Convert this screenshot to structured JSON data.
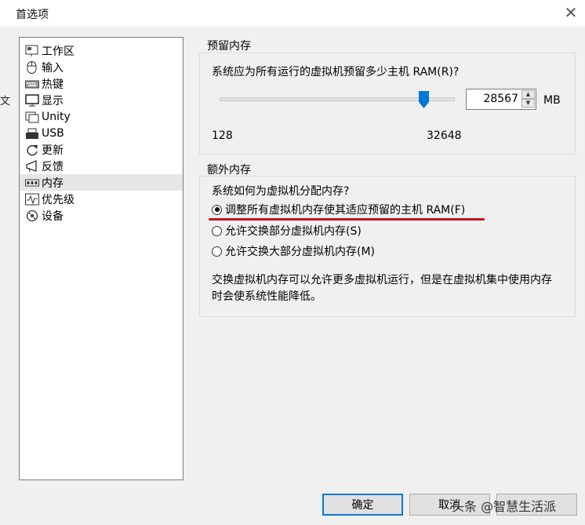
{
  "window": {
    "title": "首选项",
    "close_glyph": "✕"
  },
  "background_fragment": "文",
  "nav": {
    "items": [
      {
        "label": "工作区",
        "icon": "workspace-icon"
      },
      {
        "label": "输入",
        "icon": "mouse-icon"
      },
      {
        "label": "热键",
        "icon": "keyboard-icon"
      },
      {
        "label": "显示",
        "icon": "monitor-icon"
      },
      {
        "label": "Unity",
        "icon": "unity-icon"
      },
      {
        "label": "USB",
        "icon": "usb-icon"
      },
      {
        "label": "更新",
        "icon": "refresh-icon"
      },
      {
        "label": "反馈",
        "icon": "feedback-icon"
      },
      {
        "label": "内存",
        "icon": "memory-icon",
        "selected": true
      },
      {
        "label": "优先级",
        "icon": "priority-icon"
      },
      {
        "label": "设备",
        "icon": "device-icon"
      }
    ]
  },
  "reserved_memory": {
    "title": "预留内存",
    "question": "系统应为所有运行的虚拟机预留多少主机 RAM(R)?",
    "slider": {
      "min": 128,
      "max": 32648,
      "value": 28567
    },
    "min_label": "128",
    "max_label": "32648",
    "value_display": "28567",
    "unit": "MB"
  },
  "extra_memory": {
    "title": "额外内存",
    "question": "系统如何为虚拟机分配内存?",
    "options": [
      {
        "label": "调整所有虚拟机内存使其适应预留的主机 RAM(F)",
        "checked": true
      },
      {
        "label": "允许交换部分虚拟机内存(S)",
        "checked": false
      },
      {
        "label": "允许交换大部分虚拟机内存(M)",
        "checked": false
      }
    ],
    "note": "交换虚拟机内存可以允许更多虚拟机运行，但是在虚拟机集中使用内存时会使系统性能降低。"
  },
  "buttons": {
    "ok": "确定",
    "cancel": "取消"
  },
  "watermark": "头条 @智慧生活派",
  "colors": {
    "accent": "#0078d7",
    "annotation_red": "#c0141f"
  }
}
